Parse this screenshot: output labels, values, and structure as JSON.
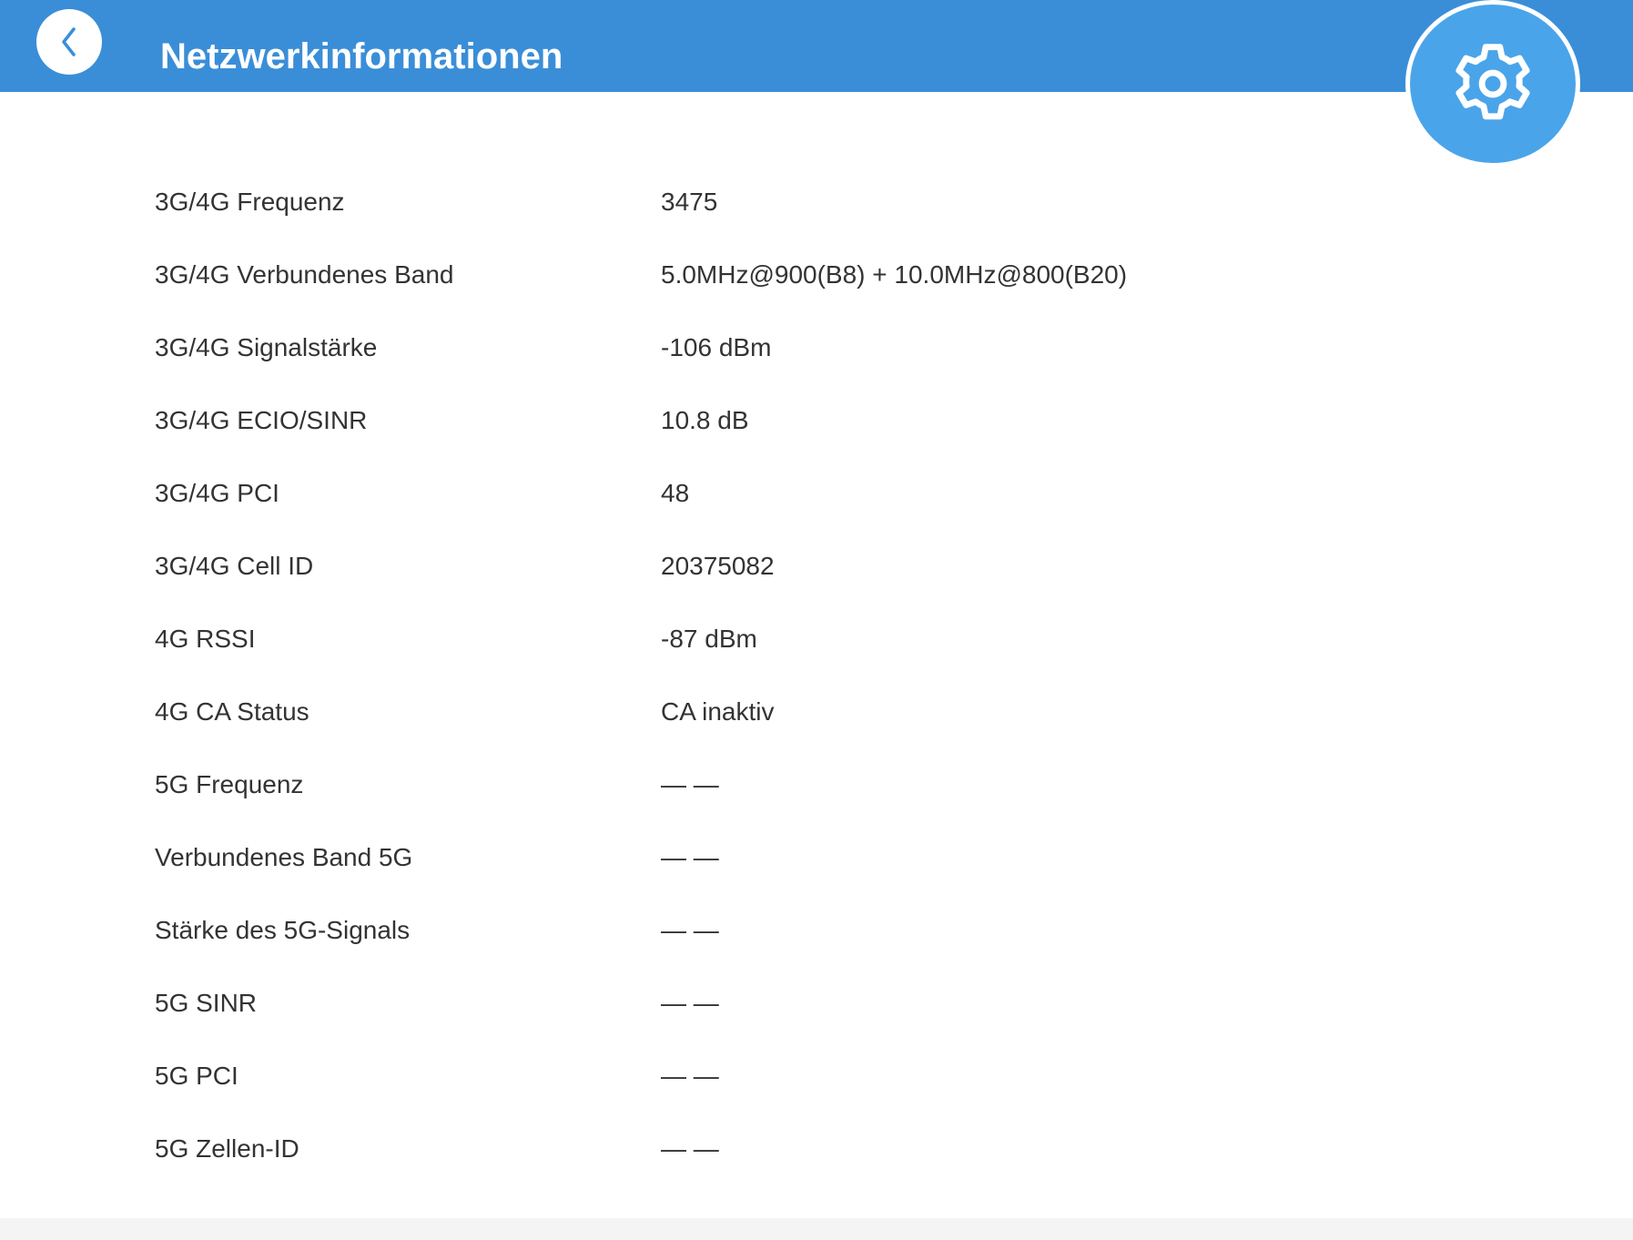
{
  "header": {
    "title": "Netzwerkinformationen",
    "back_icon": "chevron-left-icon",
    "settings_icon": "gear-icon",
    "bar_color": "#3a8ed8",
    "settings_color": "#4aa4ea"
  },
  "rows": [
    {
      "label": "3G/4G Frequenz",
      "value": "3475"
    },
    {
      "label": "3G/4G Verbundenes Band",
      "value": "5.0MHz@900(B8) + 10.0MHz@800(B20)"
    },
    {
      "label": "3G/4G Signalstärke",
      "value": "-106 dBm"
    },
    {
      "label": "3G/4G ECIO/SINR",
      "value": "10.8 dB"
    },
    {
      "label": "3G/4G PCI",
      "value": "48"
    },
    {
      "label": "3G/4G Cell ID",
      "value": "20375082"
    },
    {
      "label": "4G RSSI",
      "value": "-87 dBm"
    },
    {
      "label": "4G CA Status",
      "value": "CA inaktiv"
    },
    {
      "label": "5G Frequenz",
      "value": "— —"
    },
    {
      "label": "Verbundenes Band 5G",
      "value": "— —"
    },
    {
      "label": "Stärke des 5G-Signals",
      "value": "— —"
    },
    {
      "label": "5G SINR",
      "value": "— —"
    },
    {
      "label": "5G PCI",
      "value": "— —"
    },
    {
      "label": "5G Zellen-ID",
      "value": "— —"
    }
  ]
}
